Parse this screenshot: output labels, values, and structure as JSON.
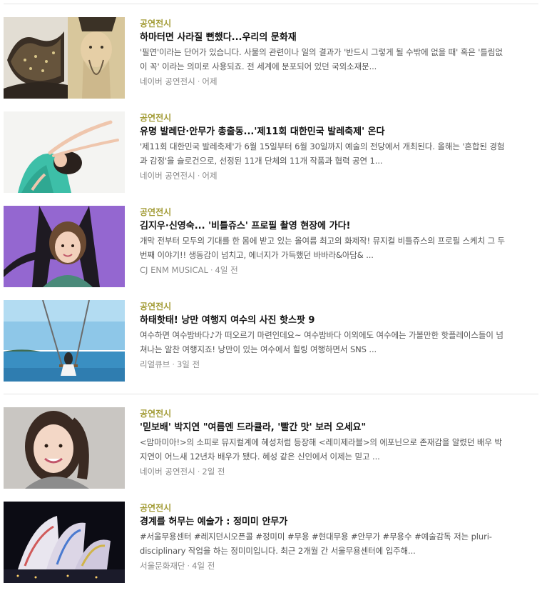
{
  "articles": [
    {
      "category": "공연전시",
      "title": "하마터면 사라질 뻔했다...우리의 문화재",
      "description": "'필연'이라는 단어가 있습니다. 사물의 관련이나 일의 결과가 '반드시 그렇게 될 수밖에 없을 때' 혹은 '틀림없이 꼭' 이라는 의미로 사용되죠. 전 세계에 분포되어 있던 국외소재문...",
      "source": "네이버 공연전시",
      "time": "어제"
    },
    {
      "category": "공연전시",
      "title": "유명 발레단·안무가 총출동...'제11회 대한민국 발레축제' 온다",
      "description": "'제11회 대한민국 발레축제'가 6월 15일부터 6월 30일까지 예술의 전당에서 개최된다. 올해는 '혼합된 경험과 감정'을 슬로건으로, 선정된 11개 단체의 11개 작품과 협력 공연 1...",
      "source": "네이버 공연전시",
      "time": "어제"
    },
    {
      "category": "공연전시",
      "title": "김지우·신영숙... '비틀쥬스' 프로필 촬영 현장에 가다!",
      "description": "개막 전부터 모두의 기대를 한 몸에 받고 있는 올여름 최고의 화제작! 뮤지컬 비틀쥬스의 프로필 스케치 그 두 번째 이야기!! 생동감이 넘치고, 에너지가 가득했던 바바라&아담& ...",
      "source": "CJ ENM MUSICAL",
      "time": "4일 전"
    },
    {
      "category": "공연전시",
      "title": "하태핫태! 낭만 여행지 여수의 사진 핫스팟 9",
      "description": "여수하면 여수밤바다♪가 떠오르기 마련인데요~ 여수밤바다 이외에도 여수에는 가볼만한 핫플레이스들이 넘쳐나는 알찬 여행지죠! 낭만이 있는 여수에서 힐링 여행하면서 SNS ...",
      "source": "리얼큐브",
      "time": "3일 전"
    },
    {
      "category": "공연전시",
      "title": "'믿보배' 박지연 \"여름엔 드라큘라, '빨간 맛' 보러 오세요\"",
      "description": "<맘마미아!>의 소피로 뮤지컬계에 혜성처럼 등장해 <레미제라블>의 에포닌으로 존재감을 알렸던 배우 박지연이 어느새 12년차 배우가 됐다. 혜성 같은 신인에서 이제는 믿고 ...",
      "source": "네이버 공연전시",
      "time": "2일 전"
    },
    {
      "category": "공연전시",
      "title": "경계를 허무는 예술가 : 정미미 안무가",
      "description": "#서울무용센터 #레지던시오픈콜 #정미미 #무용 #현대무용 #안무가 #무용수 #예술감독 저는 pluri-disciplinary 작업을 하는 정미미입니다. 최근 2개월 간 서울무용센터에 입주해...",
      "source": "서울문화재단",
      "time": "4일 전"
    }
  ]
}
